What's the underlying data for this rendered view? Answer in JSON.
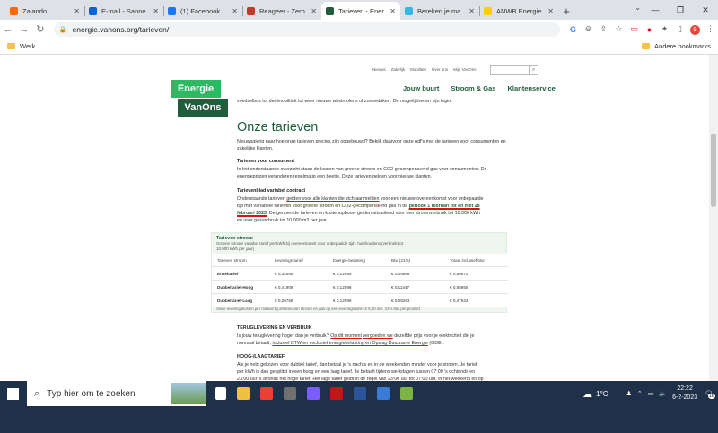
{
  "browser": {
    "tabs": [
      {
        "label": "Zalando",
        "color": "#ff6900"
      },
      {
        "label": "E-mail - Sanne",
        "color": "#0a64d6"
      },
      {
        "label": "(1) Facebook",
        "color": "#1877f2"
      },
      {
        "label": "Reageer - Zero",
        "color": "#c23a2a"
      },
      {
        "label": "Tarieven - Ener",
        "color": "#1f5d3c"
      },
      {
        "label": "Bereken je ma",
        "color": "#38b6e8"
      },
      {
        "label": "ANWB Energie",
        "color": "#ffce00"
      }
    ],
    "url": "energie.vanons.org/tarieven/",
    "bookmarks_left": "Werk",
    "bookmarks_right": "Andere bookmarks",
    "profile": "S"
  },
  "site": {
    "topnav": [
      "Nieuws",
      "Zakelijk",
      "Mobiliteit",
      "Over ons",
      "Mijn VanOns"
    ],
    "mainnav": [
      "Jouw buurt",
      "Stroom & Gas",
      "Klantenservice"
    ],
    "logo_top": "Energie",
    "logo_bottom": "VanOns",
    "intro_cut": "voedselbos tot deelmobiliteit tot weer nieuwe windmolens of zonnedaken. De mogelijkheden zijn legio.",
    "title": "Onze tarieven",
    "intro": "Nieuwsgierig naar hoe onze tarieven precies zijn opgebouwd? Bekijk daarvoor onze pdf's met de tarieven voor consumenten en zakelijke klanten.",
    "sec1_head": "Tarieven voor consument",
    "sec1_text": "In het onderstaande overzicht staan de kosten van groene stroom en CO2-gecompenseerd gas voor consumenten. De energieprijzen veranderen regelmatig een beetje. Deze tarieven gelden voor nieuwe klanten.",
    "sec2_head": "Tarievenblad variabel contract",
    "sec2_a": "Onderstaande tarieven ",
    "sec2_u1": "gelden voor alle klanten die zich aanmelden",
    "sec2_b": " voor een nieuwe overeenkomst voor onbepaalde tijd met variabele tarieven voor groene stroom en CO2-gecompenseerd gas in de ",
    "sec2_u2": "periode 1 februari tot en met 28 februari 2023",
    "sec2_c": ". De genoemde tarieven en kostenopbouw gelden uitsluitend voor een stroomverbruik tot 10.000 kWh en voor gasverbruik tot 10.000 m3 per jaar.",
    "table": {
      "title": "Tarieven stroom",
      "subtitle": "Groene stroom variabel tarief per kWh bij overeenkomst voor onbepaalde tijd - huishoudens (verbruik tot 10.000 kWh per jaar)",
      "headers": [
        "Tarieven stroom",
        "Leverings-tarief",
        "Energie-belasting",
        "Btw (21%)",
        "Totaal inclusief btw"
      ],
      "rows": [
        [
          "Enkeltarief",
          "€ 0,34485",
          "€ 0,12599",
          "€ 0,09888",
          "€ 0,56972"
        ],
        [
          "Dubbeltarief-Hoog",
          "€ 0,41909",
          "€ 0,12599",
          "€ 0,11447",
          "€ 0,65955"
        ],
        [
          "Dubbeltarief-Laag",
          "€ 0,26758",
          "€ 0,12599",
          "€ 0,08263",
          "€ 0,47622"
        ]
      ],
      "note": "Vaste leveringskosten per maand bij afname van stroom en gas op één leveringsadres € 6,50 incl. 21% btw per product"
    },
    "sec3_head": "TERUGLEVERING EN VERBRUIK",
    "sec3_a": "Is jouw teruglevering hoger dan je verbruik? ",
    "sec3_u1": "Op dit moment",
    "sec3_b": " ",
    "sec3_u2": "vergoeden we",
    "sec3_c": " dezelfde prijs voor je elektriciteit die je normaal betaalt, ",
    "sec3_u3": "inclusief BTW en exclusief energiebelasting en Opslag Duurzame Energie",
    "sec3_d": " (ODE).",
    "sec4_head": "HOOG-/LAAGTARIEF",
    "sec4_text": "Als je hebt gekozen voor dubbel tarief, dan betaal je 's nachts en in de weekenden minder voor je stroom. Je tarief per kWh is dan gesplitst in een hoog en een laag tarief. Je betaalt tijdens werkdagen tussen 07:00 's ochtends en 23:00 uur 's avonds het hoge tarief. Het lage tarief geldt in de regel van 23:00 uur tot 07:00 uur, in het weekend en op nationale"
  },
  "taskbar": {
    "search": "Typ hier om te zoeken",
    "temp": "1°C",
    "time": "22:22",
    "date": "6-2-2023",
    "notif": "16"
  }
}
